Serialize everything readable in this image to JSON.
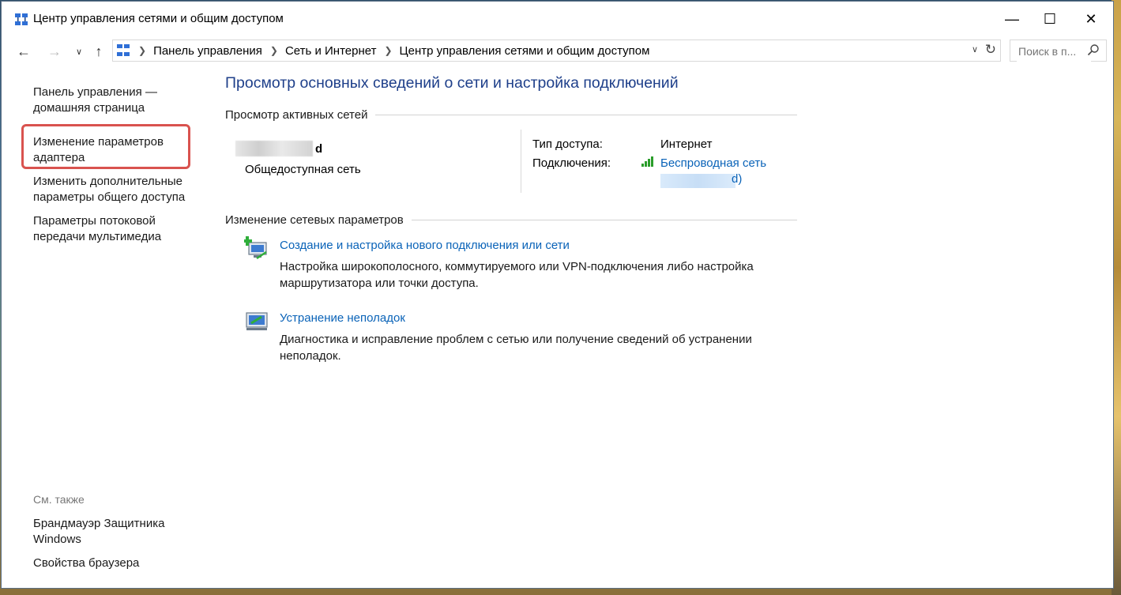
{
  "window": {
    "title": "Центр управления сетями и общим доступом",
    "minimize": "—",
    "maximize": "☐",
    "close": "✕"
  },
  "nav": {
    "back_icon": "arrow-left-icon",
    "forward_icon": "arrow-right-icon",
    "recent_icon": "chevron-down-icon",
    "up_icon": "arrow-up-icon",
    "breadcrumbs": [
      "Панель управления",
      "Сеть и Интернет",
      "Центр управления сетями и общим доступом"
    ],
    "search_placeholder": "Поиск в п..."
  },
  "sidebar": {
    "items": [
      {
        "label": "Панель управления — домашняя страница"
      },
      {
        "label": "Изменение параметров адаптера"
      },
      {
        "label": "Изменить дополнительные параметры общего доступа"
      },
      {
        "label": "Параметры потоковой передачи мультимедиа"
      }
    ],
    "see_also": "См. также",
    "see_also_items": [
      {
        "label": "Брандмауэр Защитника Windows"
      },
      {
        "label": "Свойства браузера"
      }
    ]
  },
  "main": {
    "title": "Просмотр основных сведений о сети и настройка подключений",
    "active_networks_header": "Просмотр активных сетей",
    "network": {
      "name_tail": "d",
      "type": "Общедоступная сеть",
      "access_type_label": "Тип доступа:",
      "access_type_value": "Интернет",
      "connections_label": "Подключения:",
      "connection_name": "Беспроводная сеть",
      "connection_tail": "d)"
    },
    "change_settings_header": "Изменение сетевых параметров",
    "tasks": [
      {
        "icon": "new-connection-icon",
        "title": "Создание и настройка нового подключения или сети",
        "description": "Настройка широкополосного, коммутируемого или VPN-подключения либо настройка маршрутизатора или точки доступа."
      },
      {
        "icon": "troubleshoot-icon",
        "title": "Устранение неполадок",
        "description": "Диагностика и исправление проблем с сетью или получение сведений об устранении неполадок."
      }
    ]
  },
  "colors": {
    "title_blue": "#1e3f8a",
    "link_blue": "#0a63b8",
    "highlight_red": "#d9534f"
  }
}
